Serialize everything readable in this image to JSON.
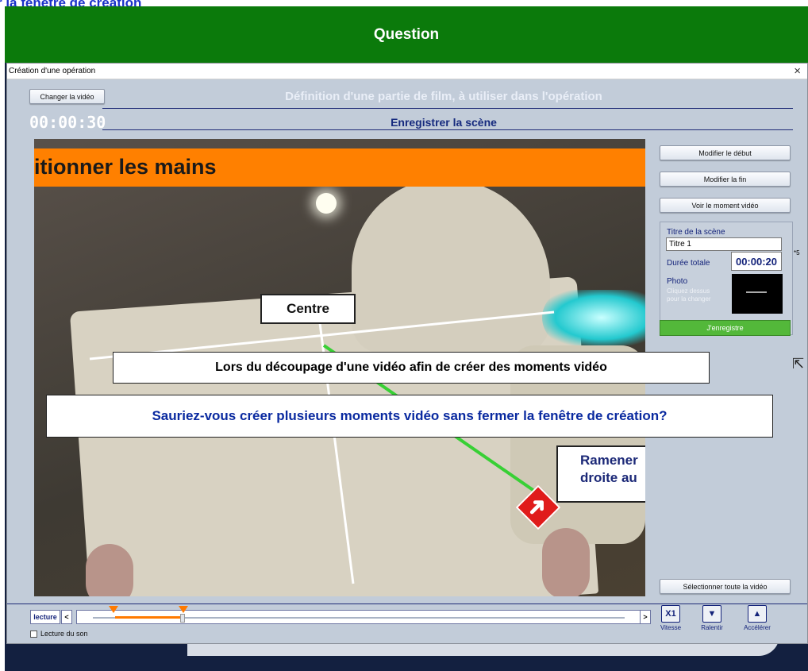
{
  "background": {
    "behind_title": "r la fenêtre de création",
    "question_header": "Question"
  },
  "dialog": {
    "title": "Création d'une opération",
    "close_icon": "×",
    "change_video_label": "Changer la vidéo",
    "header_text": "Définition d'une partie de film, à utiliser dans l'opération",
    "timecode": "00:00:30",
    "record_scene_label": "Enregistrer la scène"
  },
  "video": {
    "banner_text": "itionner les mains",
    "centre_label": "Centre",
    "ramener_label": "Ramener\ndroite au"
  },
  "right_panel": {
    "modify_start": "Modifier le début",
    "modify_end": "Modifier la fin",
    "view_moment": "Voir le moment vidéo",
    "scene_title_label": "Titre de la scène",
    "scene_title_value": "Titre 1",
    "total_duration_label": "Durée totale",
    "total_duration_value": "00:00:20",
    "photo_label": "Photo",
    "photo_hint": "Cliquez dessus pour la changer",
    "save_label": "J'enregistre",
    "select_all_label": "Sélectionner toute la vidéo",
    "asterisk_note": "*5"
  },
  "overlay_questions": {
    "context": "Lors du découpage d'une vidéo afin de créer des moments vidéo",
    "question": "Sauriez-vous créer plusieurs moments vidéo sans fermer la fenêtre de création?"
  },
  "playback": {
    "lecture_label": "lecture",
    "prev_label": "<",
    "next_label": ">",
    "sound_label": "Lecture du son",
    "speed_value": "X1",
    "speed_label": "Vitesse",
    "slow_label": "Ralentir",
    "fast_label": "Accélérer"
  },
  "colors": {
    "question_green": "#0b7a0b",
    "orange_banner": "#ff8000",
    "save_green": "#53b83a",
    "title_blue": "#162a7e"
  }
}
